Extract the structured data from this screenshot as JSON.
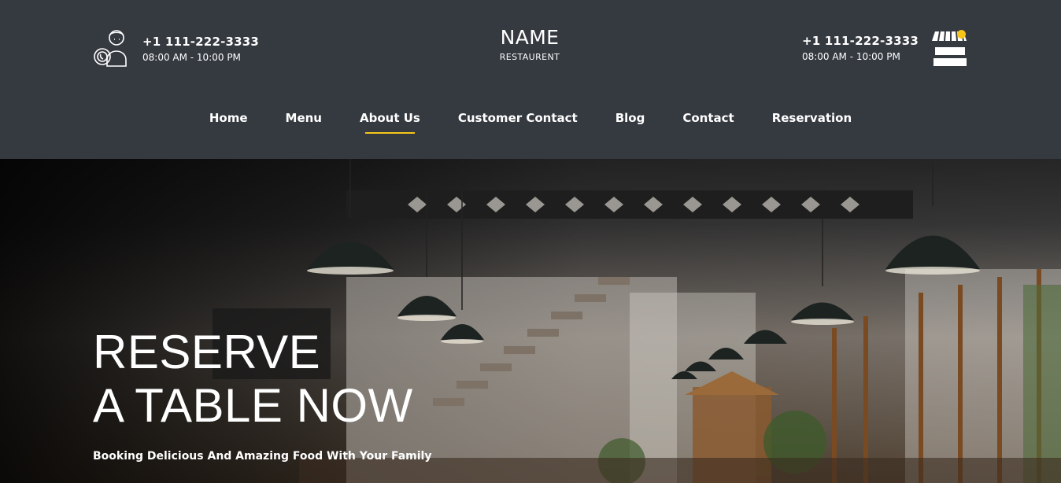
{
  "header": {
    "left_contact": {
      "phone": "+1 111-222-3333",
      "hours": "08:00 AM - 10:00 PM",
      "icon": "support-agent-icon"
    },
    "brand": {
      "name": "NAME",
      "subtitle": "RESTAURENT"
    },
    "right_contact": {
      "phone": "+1 111-222-3333",
      "hours": "08:00 AM - 10:00 PM",
      "icon": "store-icon"
    }
  },
  "nav": {
    "items": [
      {
        "label": "Home",
        "active": false
      },
      {
        "label": "Menu",
        "active": false
      },
      {
        "label": "About Us",
        "active": true
      },
      {
        "label": "Customer Contact",
        "active": false
      },
      {
        "label": "Blog",
        "active": false
      },
      {
        "label": "Contact",
        "active": false
      },
      {
        "label": "Reservation",
        "active": false
      }
    ]
  },
  "hero": {
    "title_line1": "RESERVE",
    "title_line2": "A TABLE NOW",
    "subtitle": "Booking Delicious And Amazing Food With Your Family",
    "image": "restaurant-interior-photo"
  },
  "colors": {
    "header_bg": "#353940",
    "accent": "#f5c518",
    "text": "#ffffff"
  }
}
